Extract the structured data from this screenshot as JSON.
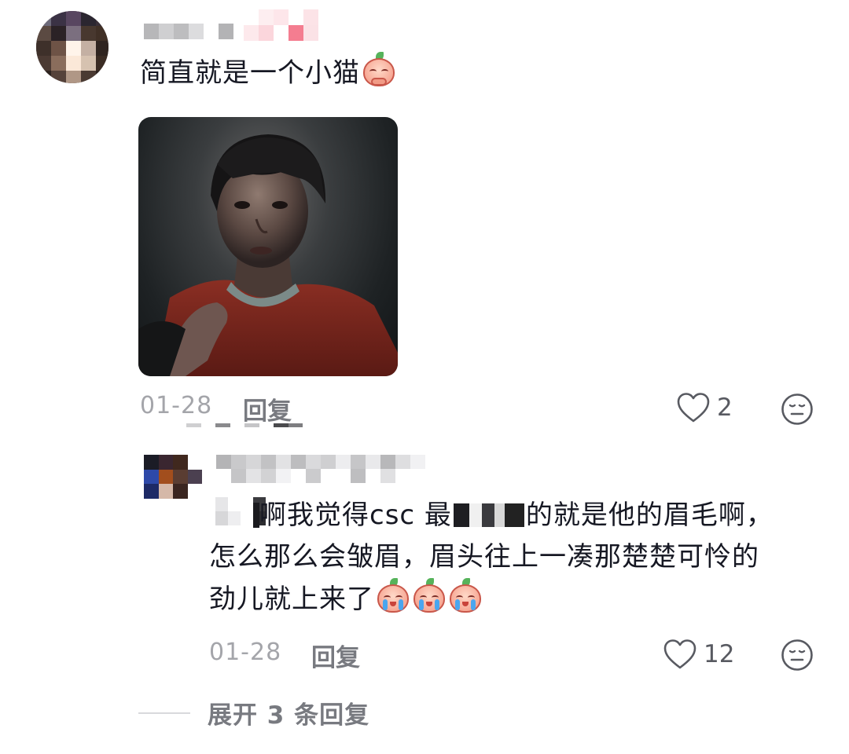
{
  "main_comment": {
    "text": "简直就是一个小猫",
    "emoji": "pleading-peach-emoji",
    "date": "01-28",
    "reply_label": "回复",
    "likes": "2"
  },
  "reply_comment": {
    "lines": [
      "啊我觉得csc 最",
      "的就是他的眉毛啊，",
      "怎么那么会皱眉，眉头往上一凑那楚楚可怜的",
      "劲儿就上来了"
    ],
    "emoji": "crying-peach-emoji",
    "date": "01-28",
    "reply_label": "回复",
    "likes": "12"
  },
  "expand_label": "展开 3 条回复",
  "icons": {
    "like": "heart-outline-icon",
    "dislike": "neutral-face-icon"
  },
  "colors": {
    "text": "#161823",
    "meta": "#a4a5aa",
    "action": "#787a80"
  }
}
